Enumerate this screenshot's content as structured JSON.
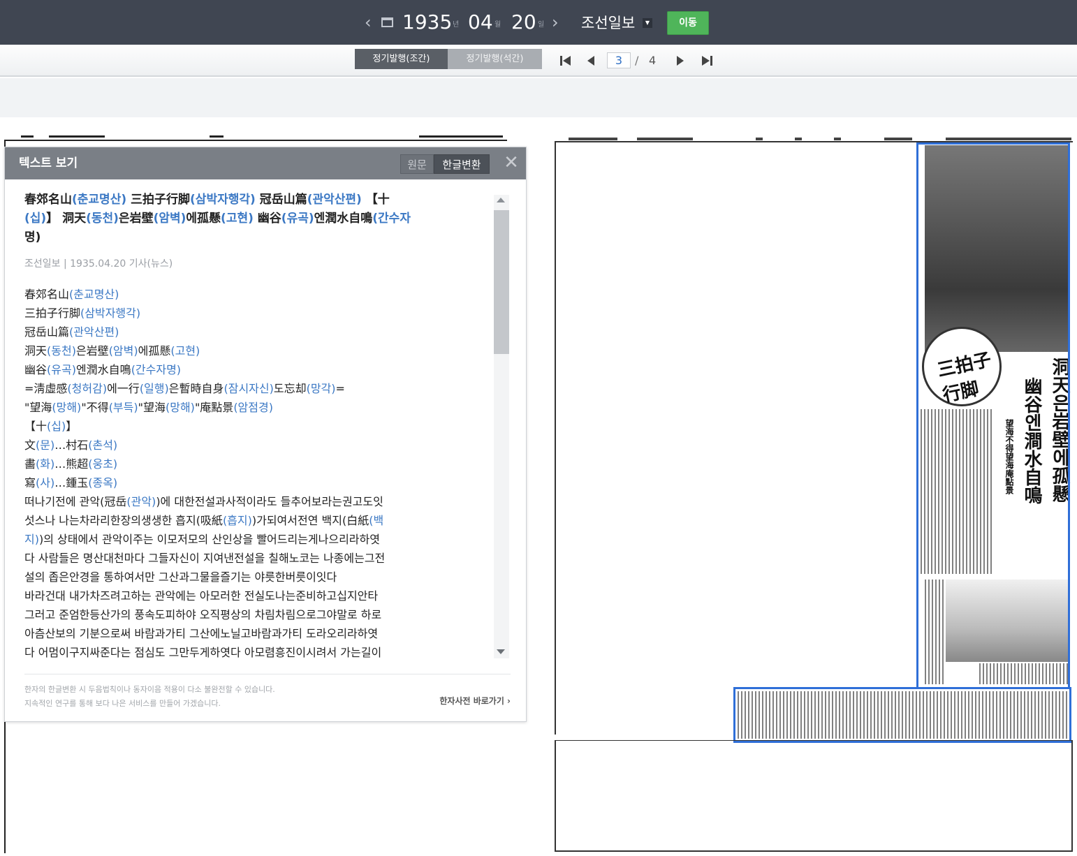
{
  "date_nav": {
    "year": "1935",
    "year_unit": "년",
    "month": "04",
    "month_unit": "월",
    "day": "20",
    "day_unit": "일",
    "newspaper": "조선일보",
    "go_label": "이동"
  },
  "edition_tabs": {
    "morning": "정기발행(조간)",
    "evening": "정기발행(석간)"
  },
  "pagination": {
    "current": "3",
    "separator": "/",
    "total": "4"
  },
  "text_panel": {
    "title": "텍스트 보기",
    "toggle_original": "원문",
    "toggle_korean": "한글변환",
    "headline": [
      [
        "春郊名山",
        "(춘교명산)",
        " 三拍子行脚",
        "(삼박자행각)",
        " 冠岳山篇",
        "(관악산편)",
        " 【十"
      ],
      [
        "(십)",
        "】 洞天",
        "(동천)",
        "은岩壁",
        "(암벽)",
        "에孤懸",
        "(고현)",
        " 幽谷",
        "(유곡)",
        "엔潤水自鳴",
        "(간수자"
      ],
      [
        "명)"
      ]
    ],
    "meta": "조선일보 | 1935.04.20 기사(뉴스)",
    "body": [
      [
        "春郊名山",
        "(춘교명산)"
      ],
      [
        "三拍子行脚",
        "(삼박자행각)"
      ],
      [
        "冠岳山篇",
        "(관악산편)"
      ],
      [
        "洞天",
        "(동천)",
        "은岩壁",
        "(암벽)",
        "에孤懸",
        "(고현)"
      ],
      [
        "幽谷",
        "(유곡)",
        "엔潤水自鳴",
        "(간수자명)"
      ],
      [
        "=淸虛感",
        "(청허감)",
        "에一行",
        "(일행)",
        "은暫時自身",
        "(잠시자신)",
        "도忘却",
        "(망각)",
        "="
      ],
      [
        "\"望海",
        "(망해)",
        "\"不得",
        "(부득)",
        "\"望海",
        "(망해)",
        "\"庵點景",
        "(암점경)"
      ],
      [
        " 【十",
        "(십)",
        "】"
      ],
      [
        "文",
        "(문)",
        "…村石",
        "(촌석)"
      ],
      [
        "畵",
        "(화)",
        "…熊超",
        "(웅초)"
      ],
      [
        "寫",
        "(사)",
        "…鍾玉",
        "(종옥)"
      ],
      [
        "떠나기전에 관악(冠岳",
        "(관악)",
        ")에 대한전설과사적이라도 들추어보라는권고도잇"
      ],
      [
        "섯스나 나는차라리한장의생생한 흡지(吸紙",
        "(흡지)",
        ")가되여서전연 백지(白紙",
        "(백"
      ],
      [
        "지)",
        ")의 상태에서 관악이주는 이모저모의 산인상을 빨어드리는게나으리라하엿"
      ],
      [
        "다 사람들은 명산대천마다 그들자신이 지여낸전설을 칠해노코는 나종에는그전"
      ],
      [
        "설의 좁은안경을 통하여서만 그산과그물을즐기는 야릇한버릇이잇다"
      ],
      [
        " 바라건대 내가차즈려고하는 관악에는 아모러한 전실도나는준비하고십지안타"
      ],
      [
        " 그러고 준엄한등산가의 풍속도피하야 오직평상의 차림차림으로그야말로 하로"
      ],
      [
        "아츰산보의 기분으로써 바람과가티 그산에노닐고바람과가티 도라오리라하엿"
      ],
      [
        "다 어멈이구지싸준다는 점심도 그만두게하엿다 아모렴흥진이시려서 가는길이"
      ]
    ],
    "notice_line1": "한자의 한글변환 시 두음법칙이나 동자이음 적용이 다소 불완전할 수 있습니다.",
    "notice_line2": "지속적인 연구를 통해 보다 나은 서비스를 만들어 가겠습니다.",
    "dict_link": "한자사전 바로가기 ›"
  },
  "newspaper_page": {
    "badge_text": "三拍子行脚",
    "title_main": "洞天은岩壁에孤懸",
    "title_sub": "幽谷엔澗水自鳴",
    "subtitle": "望海不得望海庵點景"
  },
  "colors": {
    "topbar": "#404652",
    "go_button": "#4fb55a",
    "reading_blue": "#3b78c4",
    "selection_blue": "#2f6fd8"
  }
}
